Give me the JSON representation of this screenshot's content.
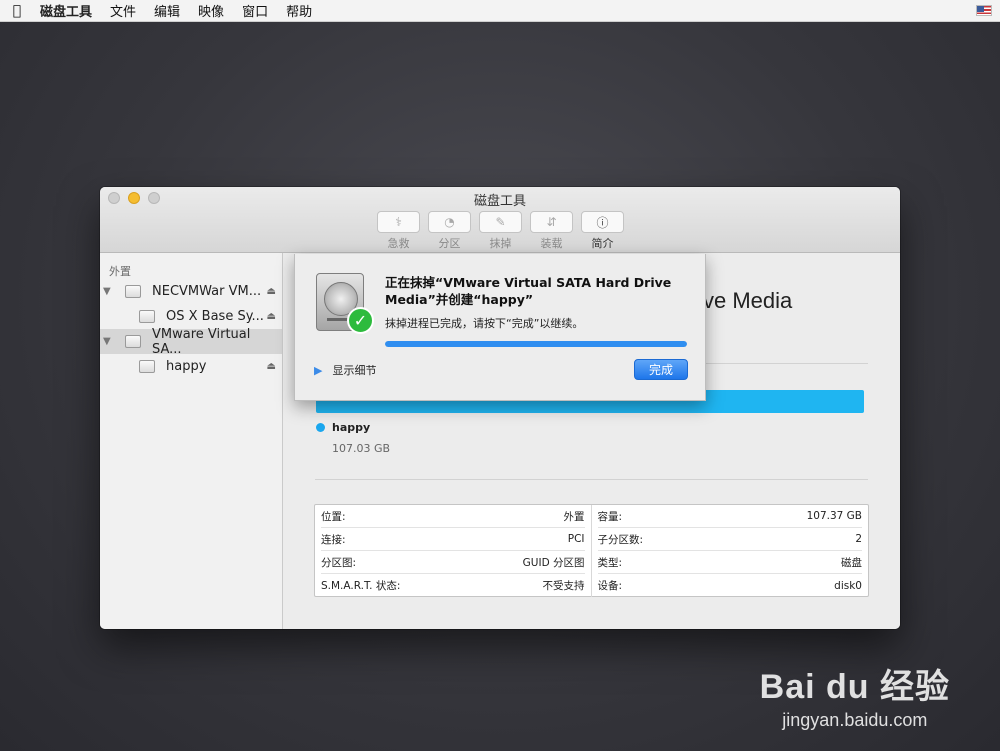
{
  "menubar": {
    "apple_icon": "",
    "app_name": "磁盘工具",
    "items": [
      "文件",
      "编辑",
      "映像",
      "窗口",
      "帮助"
    ]
  },
  "window": {
    "title": "磁盘工具",
    "toolbar": [
      {
        "label": "急救",
        "icon": "stethoscope-icon",
        "glyph": "⚕",
        "active": false
      },
      {
        "label": "分区",
        "icon": "partition-icon",
        "glyph": "◔",
        "active": false
      },
      {
        "label": "抹掉",
        "icon": "erase-icon",
        "glyph": "✎",
        "active": false
      },
      {
        "label": "装载",
        "icon": "mount-icon",
        "glyph": "⇵",
        "active": false
      },
      {
        "label": "简介",
        "icon": "info-icon",
        "glyph": "ⓘ",
        "active": true
      }
    ]
  },
  "sidebar": {
    "section_header": "外置",
    "items": [
      {
        "name": "NECVMWar VM...",
        "level": 0,
        "expanded": true,
        "eject": true,
        "selected": false
      },
      {
        "name": "OS X Base Sy...",
        "level": 1,
        "eject": true,
        "selected": false
      },
      {
        "name": "VMware Virtual SA...",
        "level": 0,
        "expanded": true,
        "eject": false,
        "selected": true
      },
      {
        "name": "happy",
        "level": 1,
        "eject": true,
        "selected": false
      }
    ]
  },
  "main": {
    "disk_title_visible": "ve Media",
    "volume": {
      "name": "happy",
      "size": "107.03 GB",
      "color": "#1fb5f1"
    },
    "info_left": [
      {
        "label": "位置:",
        "value": "外置"
      },
      {
        "label": "连接:",
        "value": "PCI"
      },
      {
        "label": "分区图:",
        "value": "GUID 分区图"
      },
      {
        "label": "S.M.A.R.T. 状态:",
        "value": "不受支持"
      }
    ],
    "info_right": [
      {
        "label": "容量:",
        "value": "107.37 GB"
      },
      {
        "label": "子分区数:",
        "value": "2"
      },
      {
        "label": "类型:",
        "value": "磁盘"
      },
      {
        "label": "设备:",
        "value": "disk0"
      }
    ]
  },
  "sheet": {
    "title": "正在抹掉“VMware Virtual SATA Hard Drive Media”并创建“happy”",
    "message": "抹掉进程已完成，请按下“完成”以继续。",
    "progress": 1.0,
    "details_label": "显示细节",
    "done_label": "完成"
  },
  "watermark": {
    "logo_text": "Bai du 经验",
    "url": "jingyan.baidu.com"
  }
}
